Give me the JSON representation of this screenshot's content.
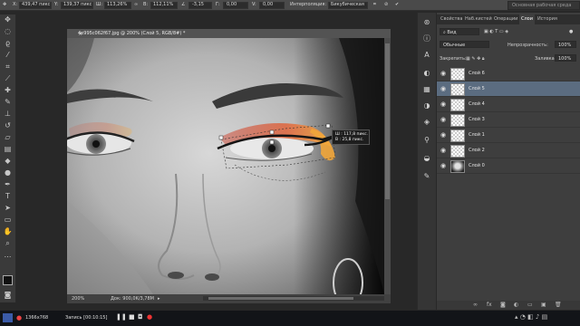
{
  "options_bar": {
    "x_value": "439,47 пикс",
    "y_value": "139,37 пикс",
    "w_value": "113,26%",
    "h_value": "112,11%",
    "angle": "-3,15",
    "hskew": "0,00",
    "vskew": "0,00",
    "interpolation_label": "Интерполяция:",
    "interpolation_value": "Бикубическая",
    "workspace": "Основная рабочая среда"
  },
  "document": {
    "title": "4e995c062f67.jpg @ 200% (Слой 5, RGB/8#) *",
    "zoom": "200%",
    "doc_size": "Док: 900,0K/3,78M"
  },
  "transform_tooltip": {
    "w": "Ш : 117,8 пикс.",
    "h": "В : 25,8 пикс."
  },
  "layers_panel": {
    "tabs": [
      "Свойства",
      "Наб.кистей",
      "Операции",
      "Слои",
      "История"
    ],
    "active_tab": "Слои",
    "filter_label": "Вид",
    "blend_mode": "Обычные",
    "opacity_label": "Непрозрачность:",
    "opacity_value": "100%",
    "lock_label": "Закрепить:",
    "fill_label": "Заливка:",
    "fill_value": "100%",
    "layers": [
      {
        "name": "Слой 6",
        "selected": false,
        "photo": false
      },
      {
        "name": "Слой 5",
        "selected": true,
        "photo": false
      },
      {
        "name": "Слой 4",
        "selected": false,
        "photo": false
      },
      {
        "name": "Слой 3",
        "selected": false,
        "photo": false
      },
      {
        "name": "Слой 1",
        "selected": false,
        "photo": false
      },
      {
        "name": "Слой 2",
        "selected": false,
        "photo": false
      },
      {
        "name": "Слой 0",
        "selected": false,
        "photo": true
      }
    ]
  },
  "taskbar": {
    "resolution": "1366x768",
    "recording": "Запись [00:10:15]"
  },
  "colors": {
    "selected_layer": "#5b6c80",
    "accent_orange": "#e3a23a"
  }
}
